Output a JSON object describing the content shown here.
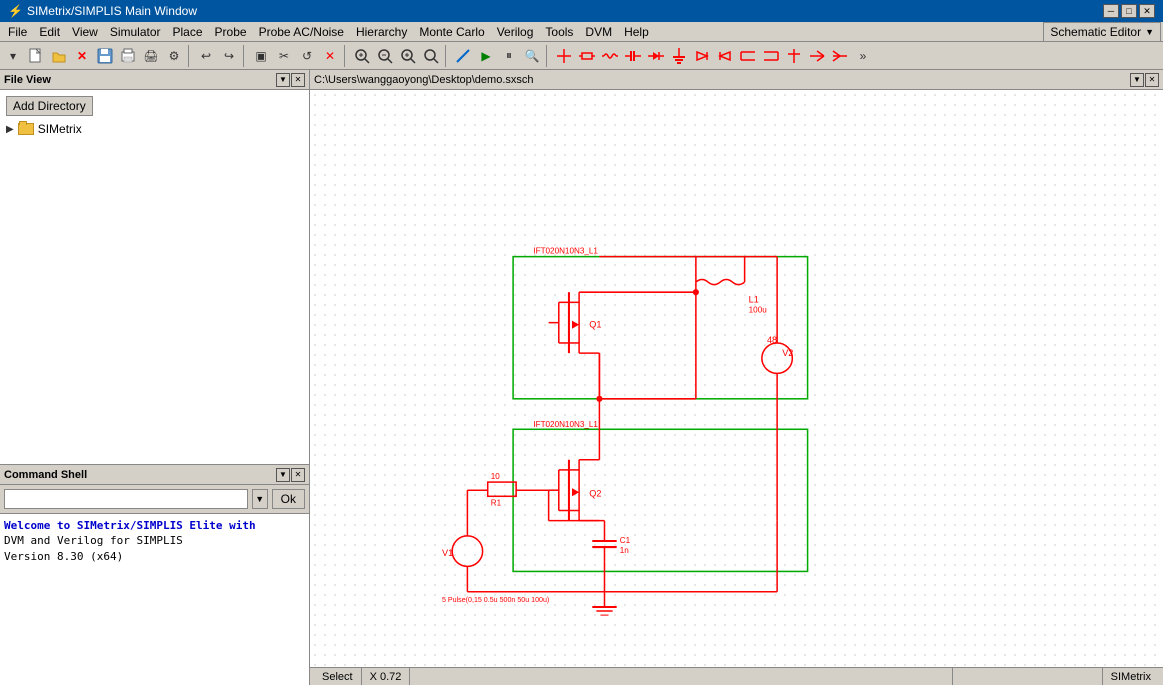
{
  "titlebar": {
    "title": "SIMetrix/SIMPLIS Main Window",
    "controls": [
      "minimize",
      "maximize",
      "close"
    ]
  },
  "menubar": {
    "items": [
      "File",
      "Edit",
      "View",
      "Simulator",
      "Place",
      "Probe",
      "Probe AC/Noise",
      "Hierarchy",
      "Monte Carlo",
      "Verilog",
      "Tools",
      "DVM",
      "Help"
    ],
    "dropdown": "Schematic Editor"
  },
  "toolbar": {
    "buttons": [
      "▾",
      "📄",
      "📁",
      "✕",
      "💾",
      "📋",
      "🖨",
      "⚙",
      "↩",
      "↪",
      "▣",
      "✂",
      "↺",
      "❌",
      "🔍",
      "🔍",
      "🔍",
      "🔍",
      "✏",
      "▶",
      "⏸",
      "🔍",
      "↕",
      "≈",
      "→",
      "○",
      "○",
      "▼",
      "▼",
      "✖",
      "✖",
      "┤",
      "├",
      "⊥",
      "⊥",
      "↑",
      "→",
      "⊲",
      "⊳",
      "»"
    ]
  },
  "fileview": {
    "title": "File View",
    "add_dir_label": "Add Directory",
    "tree": [
      {
        "label": "SIMetrix",
        "type": "folder",
        "expanded": false
      }
    ]
  },
  "cmdshell": {
    "title": "Command Shell",
    "input_placeholder": "",
    "ok_label": "Ok",
    "output": [
      "Welcome to SIMetrix/SIMPLIS Elite with",
      "DVM and Verilog for SIMPLIS",
      "Version 8.30 (x64)"
    ],
    "output_highlight": "Welcome to SIMetrix/SIMPLIS Elite with"
  },
  "schematic": {
    "path": "C:\\Users\\wanggaoyong\\Desktop\\demo.sxsch",
    "statusbar": {
      "select_label": "Select",
      "coord_label": "X 0.72",
      "app_label": "SIMetrix"
    }
  },
  "icons": {
    "minimize": "─",
    "maximize": "□",
    "close": "✕",
    "panel_minimize": "▼",
    "panel_close": "✕",
    "chevron_down": "▼"
  }
}
